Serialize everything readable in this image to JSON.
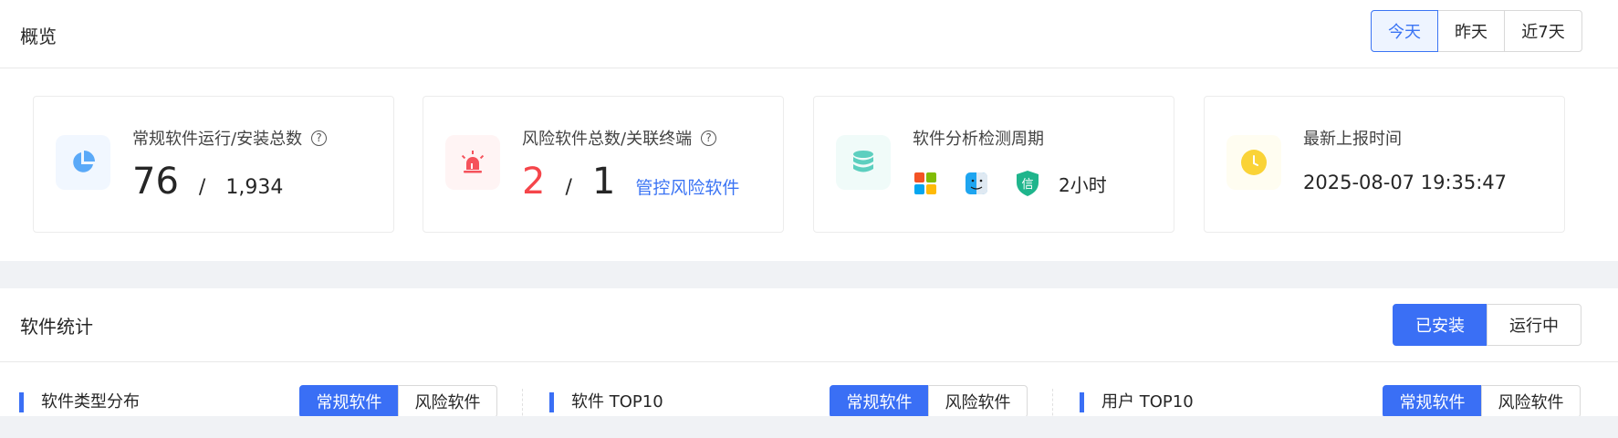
{
  "overview": {
    "title": "概览",
    "range_tabs": [
      {
        "label": "今天",
        "active": true
      },
      {
        "label": "昨天",
        "active": false
      },
      {
        "label": "近7天",
        "active": false
      }
    ],
    "cards": {
      "normal": {
        "label": "常规软件运行/安装总数",
        "running": "76",
        "installed": "1,934",
        "separator": "/"
      },
      "risk": {
        "label": "风险软件总数/关联终端",
        "total": "2",
        "terminals": "1",
        "separator": "/",
        "manage_link": "管控风险软件"
      },
      "cycle": {
        "label": "软件分析检测周期",
        "os_icons": [
          "windows-icon",
          "macos-finder-icon",
          "xinchuang-shield-icon"
        ],
        "shield_char": "信",
        "period": "2小时"
      },
      "report": {
        "label": "最新上报时间",
        "time": "2025-08-07 19:35:47"
      }
    },
    "colors": {
      "accent": "#3a6ff5",
      "risk_red": "#f5454a",
      "pie_blue": "#5aa9f8",
      "alarm_red": "#f5525b",
      "db_teal": "#5ccfbf",
      "clock_yellow": "#fad337"
    }
  },
  "stats": {
    "title": "软件统计",
    "tabs": [
      {
        "label": "已安装",
        "active": true
      },
      {
        "label": "运行中",
        "active": false
      }
    ],
    "sections": [
      {
        "title": "软件类型分布",
        "toggle": [
          "常规软件",
          "风险软件"
        ]
      },
      {
        "title": "软件 TOP10",
        "toggle": [
          "常规软件",
          "风险软件"
        ]
      },
      {
        "title": "用户 TOP10",
        "toggle": [
          "常规软件",
          "风险软件"
        ]
      }
    ]
  }
}
